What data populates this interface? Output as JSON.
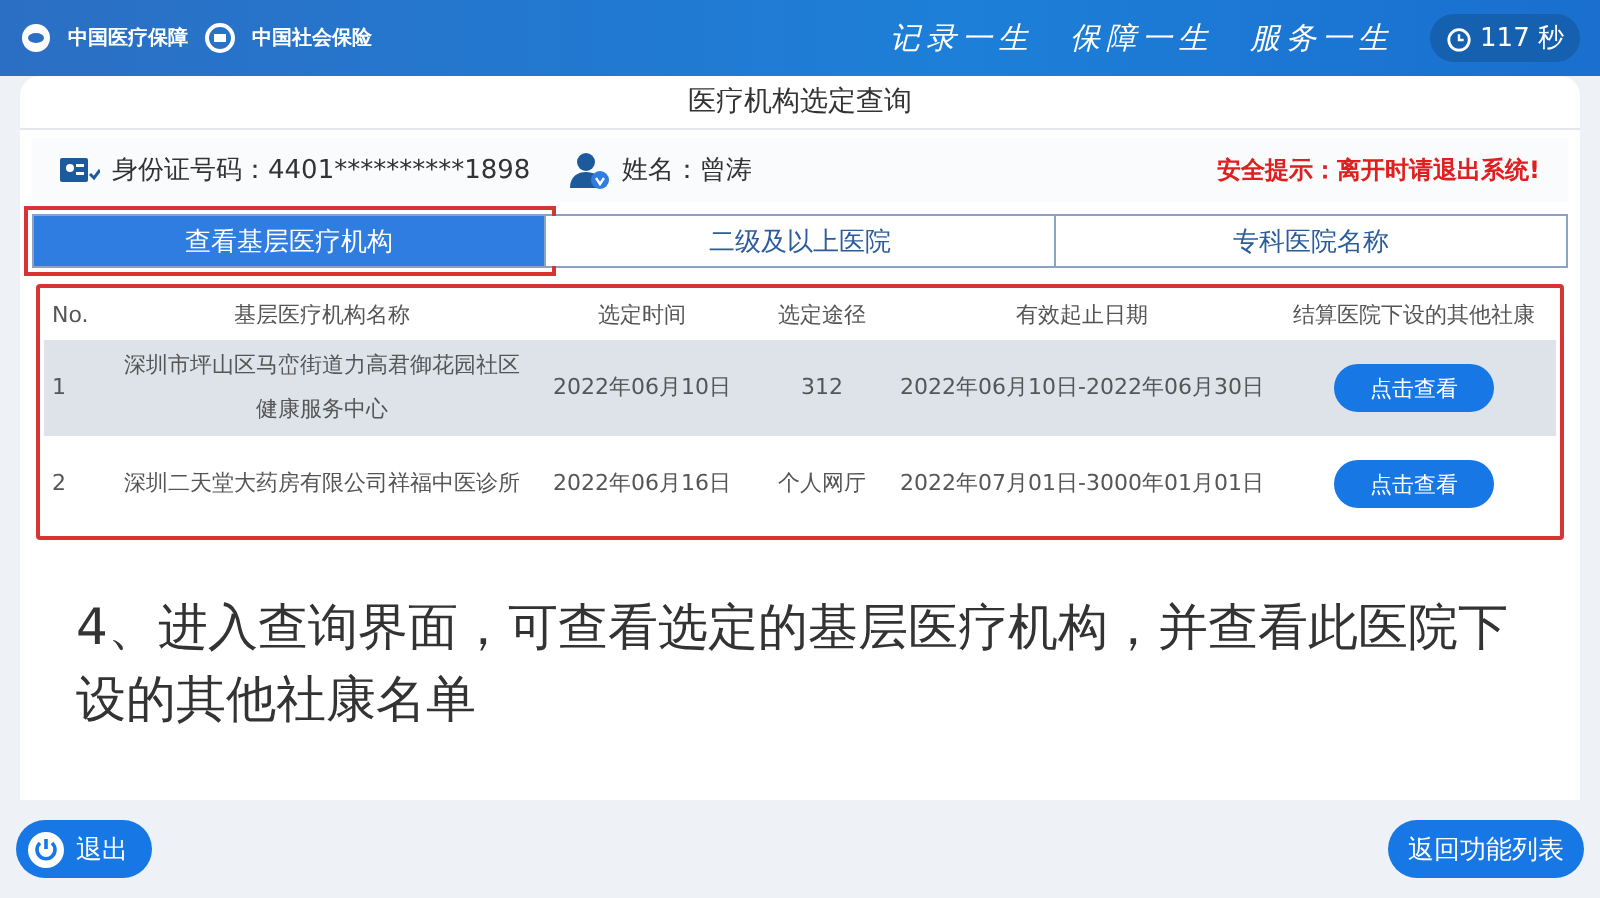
{
  "header": {
    "logos": [
      "中国医疗保障",
      "中国社会保险"
    ],
    "slogans": [
      "记录一生",
      "保障一生",
      "服务一生"
    ],
    "countdown": {
      "value": "117",
      "unit": "秒"
    }
  },
  "panel": {
    "title": "医疗机构选定查询",
    "id_label": "身份证号码：",
    "id_value": "4401**********1898",
    "name_label": "姓名：",
    "name_value": "曾涛",
    "warning": "安全提示：离开时请退出系统!",
    "tabs": [
      {
        "label": "查看基层医疗机构",
        "selected": true,
        "highlighted": true
      },
      {
        "label": "二级及以上医院",
        "selected": false,
        "highlighted": false
      },
      {
        "label": "专科医院名称",
        "selected": false,
        "highlighted": false
      }
    ],
    "table": {
      "highlighted": true,
      "columns": [
        "No.",
        "基层医疗机构名称",
        "选定时间",
        "选定途径",
        "有效起止日期",
        "结算医院下设的其他社康"
      ],
      "rows": [
        {
          "no": "1",
          "name": "深圳市坪山区马峦街道力高君御花园社区健康服务中心",
          "date": "2022年06月10日",
          "channel": "312",
          "period": "2022年06月10日-2022年06月30日",
          "action": "点击查看",
          "selected": true
        },
        {
          "no": "2",
          "name": "深圳二天堂大药房有限公司祥福中医诊所",
          "date": "2022年06月16日",
          "channel": "个人网厅",
          "period": "2022年07月01日-3000年01月01日",
          "action": "点击查看",
          "selected": false
        }
      ]
    },
    "caption": "4、进入查询界面，可查看选定的基层医疗机构，并查看此医院下设的其他社康名单"
  },
  "footer": {
    "exit": "退出",
    "back": "返回功能列表"
  }
}
